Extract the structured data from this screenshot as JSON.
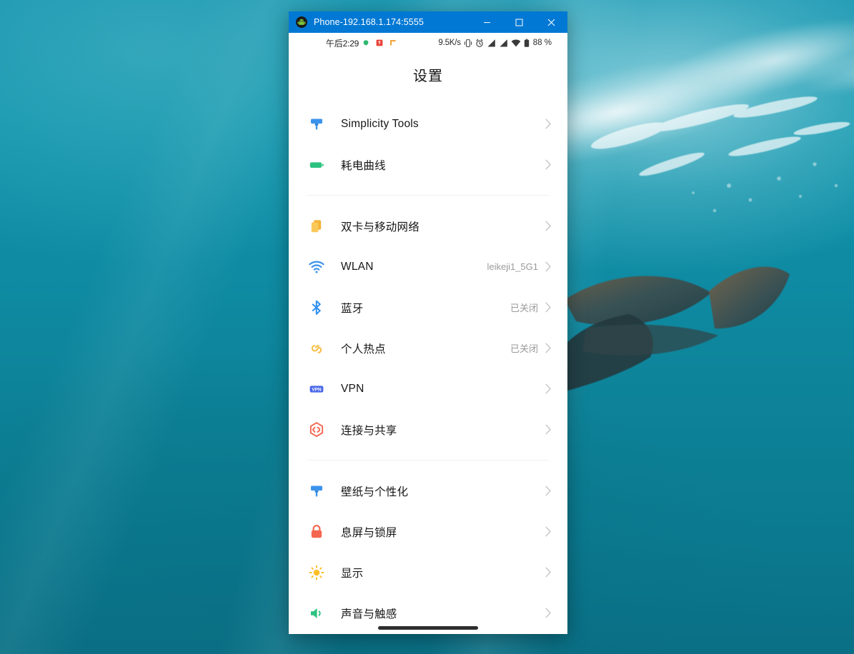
{
  "window": {
    "title": "Phone-192.168.1.174:5555",
    "app_icon": "android-robot-icon",
    "controls": {
      "minimize_label": "Minimize",
      "maximize_label": "Maximize",
      "close_label": "Close"
    },
    "titlebar_color": "#0078d4"
  },
  "statusbar": {
    "time": "午后2:29",
    "notification_icons": [
      "green-app-dot-icon",
      "red-app-badge-icon",
      "orange-app-badge-icon"
    ],
    "network_speed": "9.5K/s",
    "right_icons": [
      "vibrate-icon",
      "alarm-clock-icon",
      "signal-sim1-icon",
      "signal-sim2-icon",
      "wifi-icon",
      "battery-icon"
    ],
    "battery_percent": "88 %"
  },
  "page": {
    "title": "设置"
  },
  "groups": [
    {
      "name": "tools-group",
      "items": [
        {
          "icon": "paint-roller-icon",
          "icon_color": "#3b93ec",
          "label": "Simplicity Tools",
          "value": ""
        },
        {
          "icon": "battery-curve-icon",
          "icon_color": "#2bc27f",
          "label": "耗电曲线",
          "value": ""
        }
      ]
    },
    {
      "name": "connectivity-group",
      "items": [
        {
          "icon": "sim-cards-icon",
          "icon_color": "#fbbd3a",
          "label": "双卡与移动网络",
          "value": ""
        },
        {
          "icon": "wifi-icon",
          "icon_color": "#3b93ec",
          "label": "WLAN",
          "value": "leikeji1_5G1"
        },
        {
          "icon": "bluetooth-icon",
          "icon_color": "#2e8ef0",
          "label": "蓝牙",
          "value": "已关闭"
        },
        {
          "icon": "hotspot-icon",
          "icon_color": "#f7c04a",
          "label": "个人热点",
          "value": "已关闭"
        },
        {
          "icon": "vpn-badge-icon",
          "icon_color": "#4b68e8",
          "label": "VPN",
          "value": ""
        },
        {
          "icon": "connect-share-icon",
          "icon_color": "#f4674f",
          "label": "连接与共享",
          "value": ""
        }
      ]
    },
    {
      "name": "personalization-group",
      "items": [
        {
          "icon": "wallpaper-brush-icon",
          "icon_color": "#3b93ec",
          "label": "壁纸与个性化",
          "value": ""
        },
        {
          "icon": "lock-icon",
          "icon_color": "#f4674f",
          "label": "息屏与锁屏",
          "value": ""
        },
        {
          "icon": "brightness-sun-icon",
          "icon_color": "#fdbe2a",
          "label": "显示",
          "value": ""
        },
        {
          "icon": "speaker-icon",
          "icon_color": "#2bc27f",
          "label": "声音与触感",
          "value": ""
        }
      ]
    }
  ],
  "home_indicator": "home-gesture-bar"
}
